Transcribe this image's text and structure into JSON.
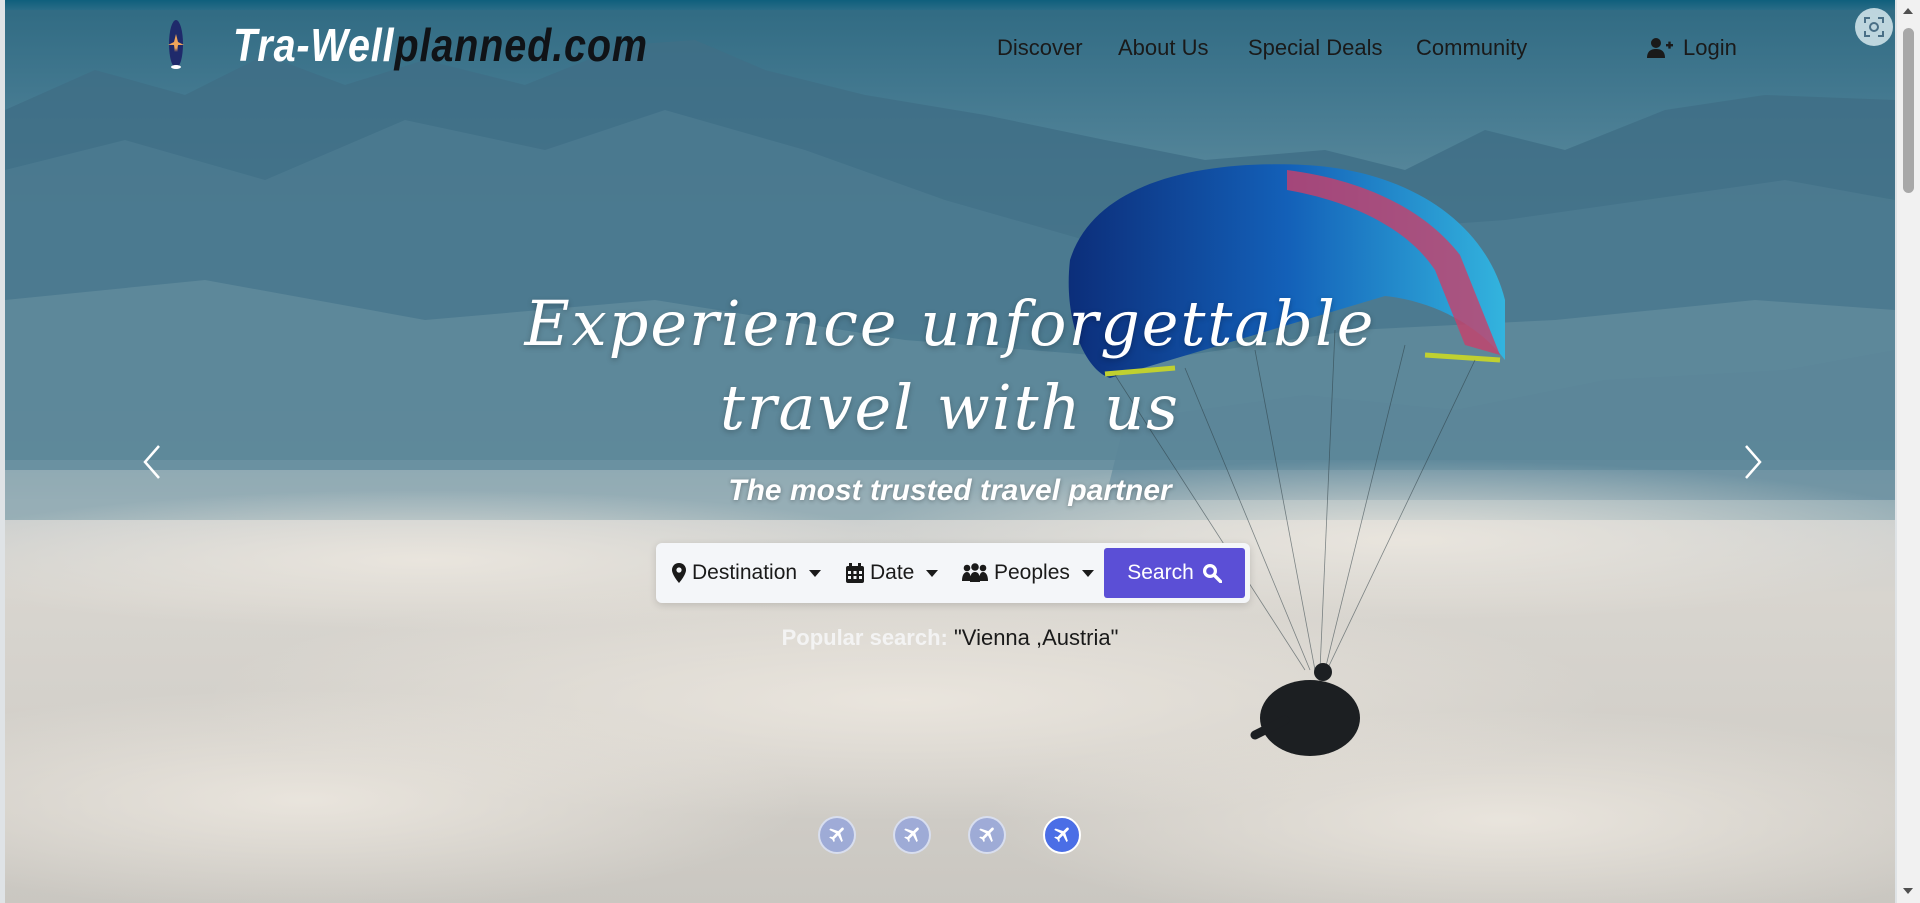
{
  "brand": {
    "part1": "Tra-Well",
    "part2": "planned.com"
  },
  "nav": {
    "items": [
      {
        "label": "Discover"
      },
      {
        "label": "About Us"
      },
      {
        "label": "Special Deals"
      },
      {
        "label": "Community"
      }
    ],
    "login_label": "Login"
  },
  "hero": {
    "headline_line1": "Experience unforgettable",
    "headline_line2": "travel with us",
    "subheadline": "The most trusted travel partner"
  },
  "search": {
    "destination_label": "Destination",
    "date_label": "Date",
    "peoples_label": "Peoples",
    "button_label": "Search"
  },
  "popular": {
    "label": "Popular search:",
    "value": "\"Vienna ,Austria\""
  },
  "carousel": {
    "slide_count": 4,
    "active_index": 3
  },
  "colors": {
    "accent": "#5b4fd6",
    "active_dot": "#4a6ee6",
    "nav_text": "#1a1a1a"
  },
  "icons": {
    "logo": "surfboard-plane-icon",
    "destination": "map-marker-icon",
    "date": "calendar-icon",
    "peoples": "users-icon",
    "search": "search-icon",
    "login": "user-plus-icon",
    "screenshot": "screen-capture-icon",
    "prev": "chevron-left-icon",
    "next": "chevron-right-icon",
    "dot": "airplane-icon"
  }
}
